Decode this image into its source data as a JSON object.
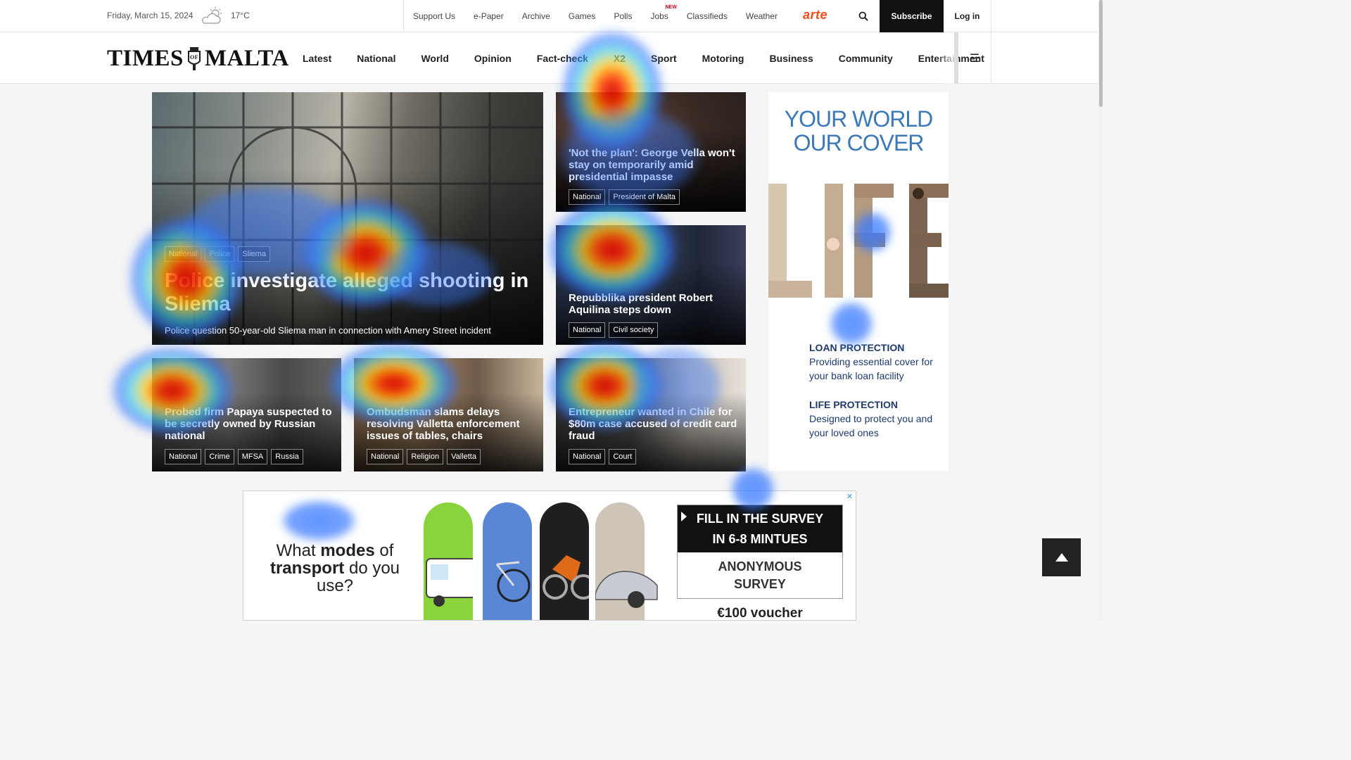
{
  "topbar": {
    "date": "Friday, March 15, 2024",
    "temperature": "17°C",
    "weather_icon": "partly-cloudy-icon",
    "links": [
      "Support Us",
      "e-Paper",
      "Archive",
      "Games",
      "Polls",
      "Jobs",
      "Classifieds",
      "Weather"
    ],
    "jobs_badge": "NEW",
    "partner_logo": "arte",
    "subscribe_label": "Subscribe",
    "login_label": "Log in"
  },
  "nav": {
    "logo_left": "TIMES",
    "logo_right": "MALTA",
    "items": [
      "Latest",
      "National",
      "World",
      "Opinion",
      "Fact-check",
      "X2",
      "Sport",
      "Motoring",
      "Business",
      "Community",
      "Entertainment"
    ],
    "menu_icon": "hamburger-icon"
  },
  "hero": {
    "tags": [
      "National",
      "Police",
      "Sliema"
    ],
    "headline": "Police investigate alleged shooting in Sliema",
    "summary": "Police question 50-year-old Sliema man in connection with Amery Street incident"
  },
  "side_cards": [
    {
      "headline": "'Not the plan': George Vella won't stay on temporarily amid presidential impasse",
      "tags": [
        "National",
        "President of Malta"
      ]
    },
    {
      "headline": "Repubblika president Robert Aquilina steps down",
      "tags": [
        "National",
        "Civil society"
      ]
    }
  ],
  "bottom_cards": [
    {
      "headline": "Probed firm Papaya suspected to be secretly owned by Russian national",
      "tags": [
        "National",
        "Crime",
        "MFSA",
        "Russia"
      ]
    },
    {
      "headline": "Ombudsman slams delays resolving Valletta enforcement issues of tables, chairs",
      "tags": [
        "National",
        "Religion",
        "Valletta"
      ]
    },
    {
      "headline": "Entrepreneur wanted in Chile for $80m case accused of credit card fraud",
      "tags": [
        "National",
        "Court"
      ]
    }
  ],
  "side_ad": {
    "headline_line1": "YOUR WORLD",
    "headline_line2": "OUR COVER",
    "image_word": "LIFE",
    "product1_title": "LOAN PROTECTION",
    "product1_desc": "Providing essential cover for your bank loan facility",
    "product2_title": "LIFE PROTECTION",
    "product2_desc": "Designed to protect you and your loved ones"
  },
  "banner_ad": {
    "question_part1": "What ",
    "question_bold1": "modes",
    "question_part2": " of ",
    "question_bold2": "transport",
    "question_part3": " do you use?",
    "survey_title_line1": "FILL IN THE SURVEY",
    "survey_title_line2": "IN 6-8 MINTUES",
    "survey_sub_line1": "ANONYMOUS",
    "survey_sub_line2": "SURVEY",
    "voucher": "€100 voucher",
    "close_icon": "ad-close-icon"
  },
  "colors": {
    "arte_orange": "#f14b1a",
    "jobs_badge_red": "#d6001c",
    "ad_blue": "#3a78b9",
    "ad_navy": "#1d3a6b"
  }
}
